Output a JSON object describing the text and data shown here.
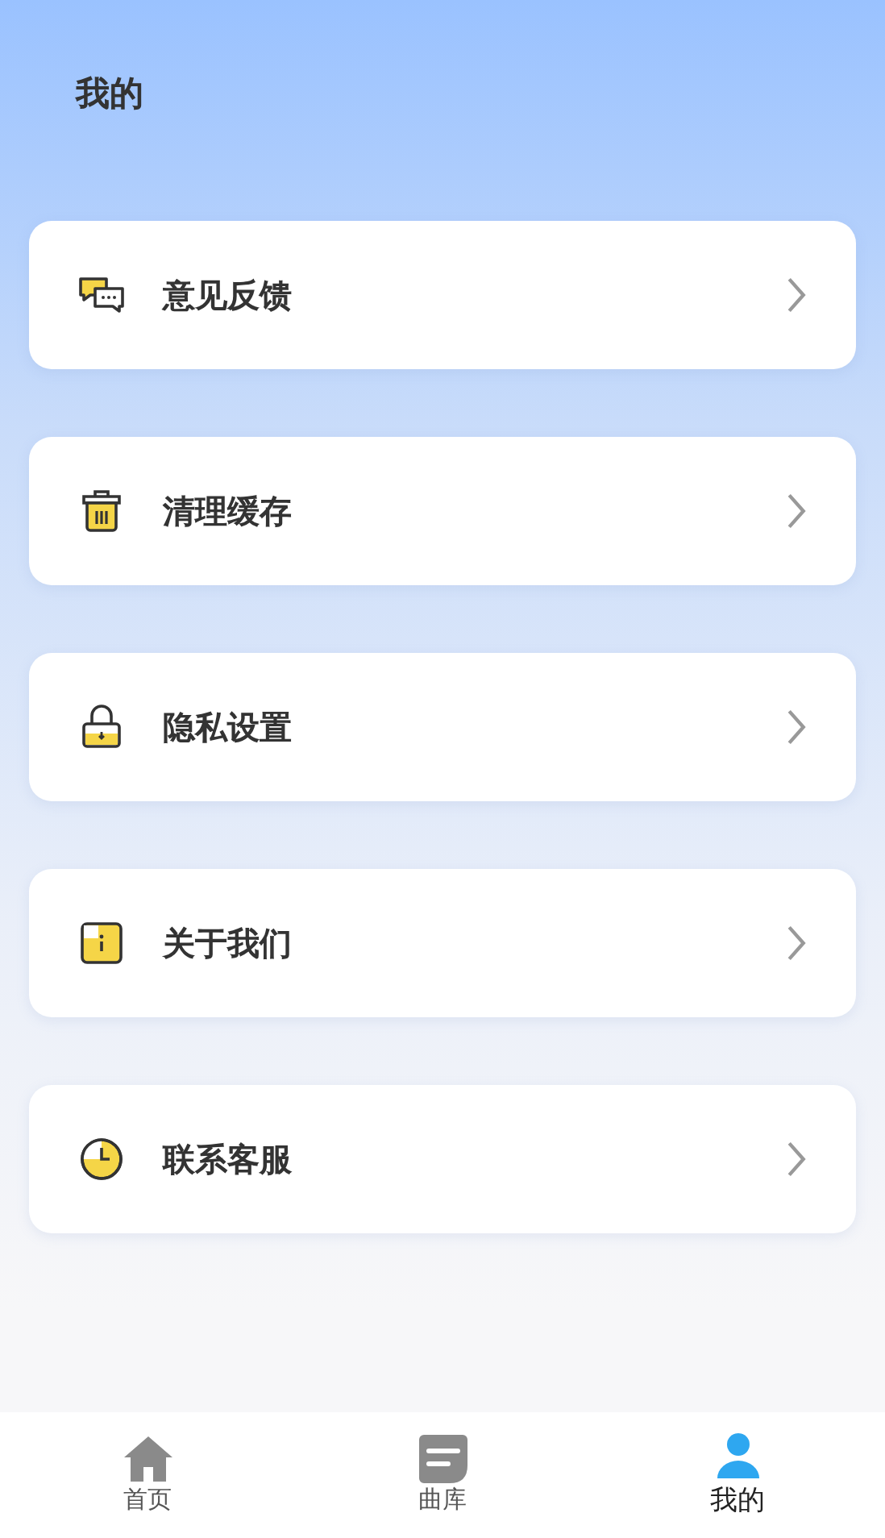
{
  "header": {
    "title": "我的"
  },
  "menu": [
    {
      "kind": "feedback",
      "label": "意见反馈"
    },
    {
      "kind": "trash",
      "label": "清理缓存"
    },
    {
      "kind": "lock",
      "label": "隐私设置"
    },
    {
      "kind": "info",
      "label": "关于我们"
    },
    {
      "kind": "clock",
      "label": "联系客服"
    }
  ],
  "tabs": [
    {
      "kind": "home",
      "label": "首页",
      "selected": false
    },
    {
      "kind": "library",
      "label": "曲库",
      "selected": false
    },
    {
      "kind": "person",
      "label": "我的",
      "selected": true
    }
  ]
}
